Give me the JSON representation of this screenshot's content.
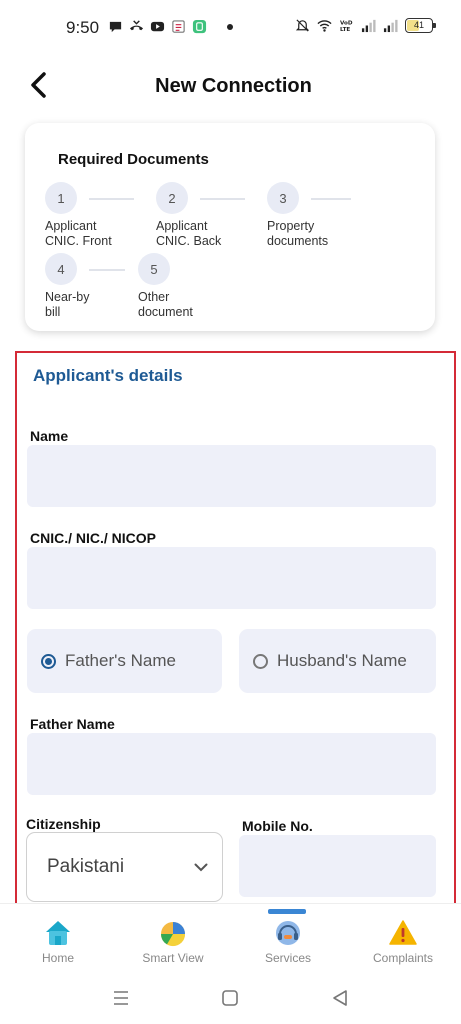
{
  "status_bar": {
    "time": "9:50",
    "battery": "41"
  },
  "header": {
    "title": "New Connection"
  },
  "documents": {
    "title": "Required Documents",
    "steps": [
      {
        "num": "1",
        "label": "Applicant\nCNIC. Front"
      },
      {
        "num": "2",
        "label": "Applicant\nCNIC. Back"
      },
      {
        "num": "3",
        "label": "Property\ndocuments"
      },
      {
        "num": "4",
        "label": "Near-by\nbill"
      },
      {
        "num": "5",
        "label": "Other\ndocument"
      }
    ]
  },
  "form": {
    "section_title": "Applicant's details",
    "name_label": "Name",
    "name_value": "",
    "cnic_label": "CNIC./ NIC./ NICOP",
    "cnic_value": "",
    "relation_options": {
      "father": "Father's Name",
      "husband": "Husband's Name",
      "selected": "father"
    },
    "father_name_label": "Father Name",
    "father_name_value": "",
    "citizenship_label": "Citizenship",
    "citizenship_value": "Pakistani",
    "mobile_label": "Mobile No.",
    "mobile_value": ""
  },
  "bottom_nav": {
    "items": [
      {
        "label": "Home",
        "icon": "home-icon"
      },
      {
        "label": "Smart View",
        "icon": "pie-chart-icon"
      },
      {
        "label": "Services",
        "icon": "headset-icon"
      },
      {
        "label": "Complaints",
        "icon": "warning-icon"
      }
    ],
    "active": "Services"
  },
  "colors": {
    "accent": "#1e5a94",
    "highlight_border": "#d42a37",
    "field_bg": "#eef0f9",
    "nav_indicator": "#3a86d4"
  }
}
